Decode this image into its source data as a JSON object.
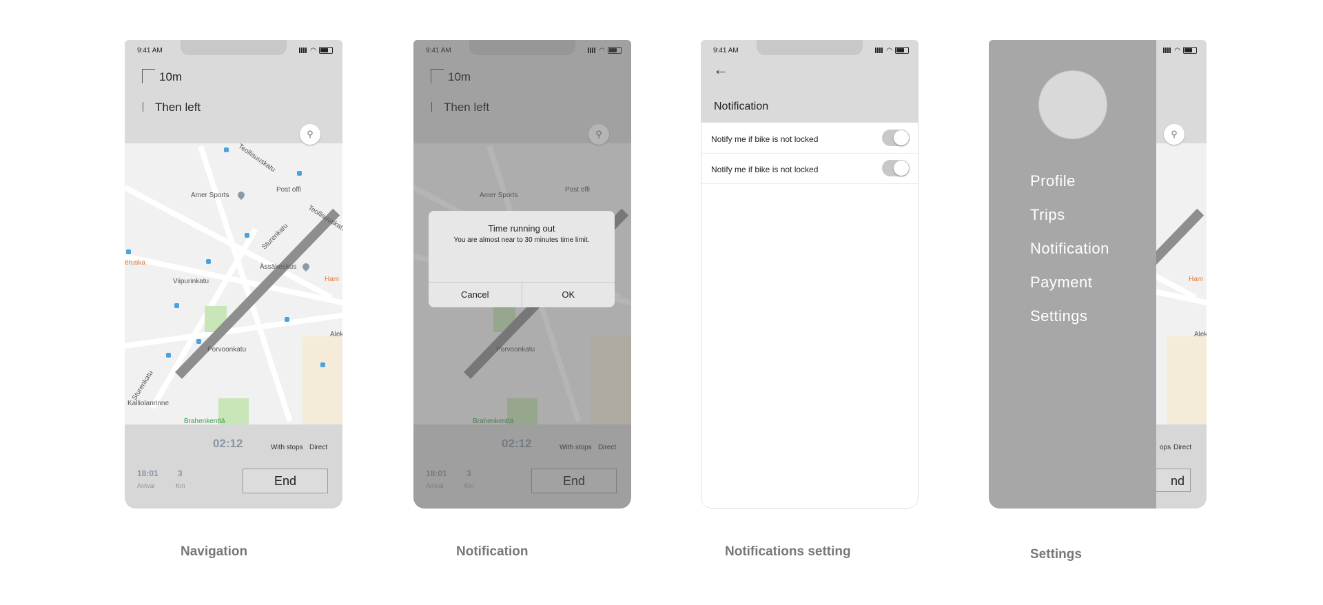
{
  "status": {
    "time": "9:41 AM",
    "cat_icon": "cat-icon",
    "signal_icon": "signal-bars-icon",
    "wifi_icon": "wifi-icon",
    "battery_icon": "battery-icon"
  },
  "navigation": {
    "distance": "10m",
    "next_instruction": "Then left",
    "timer": "02:12",
    "option_with_stops": "With stops",
    "option_direct": "Direct",
    "arrival_time": "18:01",
    "arrival_label": "Arrival",
    "distance_km": "3",
    "km_label": "Km",
    "end_button": "End"
  },
  "map_labels": {
    "teollisuuskatu": "Teollisuuskatu",
    "amer_sports": "Amer Sports",
    "post_office": "Post offi",
    "teollisuuskatu2": "Teollisuuskatu",
    "sturenkatu": "Sturenkatu",
    "assakeskus": "Ässäkeskus",
    "viipurinkatu": "Viipurinkatu",
    "eruska": "eruska",
    "ham": "Ham",
    "porvoonkatu": "Porvoonkatu",
    "sturenkatu2": "Sturenkatu",
    "kallo": "Kalliolanrinne",
    "brahen": "Brahenkenttä",
    "aleksi": "Aleksi"
  },
  "dialog": {
    "title": "Time running out",
    "message": "You are almost near to 30 minutes time limit.",
    "cancel": "Cancel",
    "ok": "OK"
  },
  "notification_settings": {
    "title": "Notification",
    "rows": [
      {
        "label": "Notify me if bike is not locked",
        "enabled": true
      },
      {
        "label": "Notify me if bike is not locked",
        "enabled": true
      }
    ]
  },
  "settings_menu": {
    "items": [
      "Profile",
      "Trips",
      "Notification",
      "Payment",
      "Settings"
    ],
    "behind_opt1": "ops",
    "behind_opt2": "Direct",
    "behind_end": "nd"
  },
  "captions": {
    "navigation": "Navigation",
    "notification": "Notification",
    "notifications_setting": "Notifications setting",
    "settings": "Settings"
  },
  "colors": {
    "route": "#8e8e8e",
    "timer": "#8a96a3",
    "drawer": "#a7a7a7",
    "overlay": "#5a5a5a"
  }
}
